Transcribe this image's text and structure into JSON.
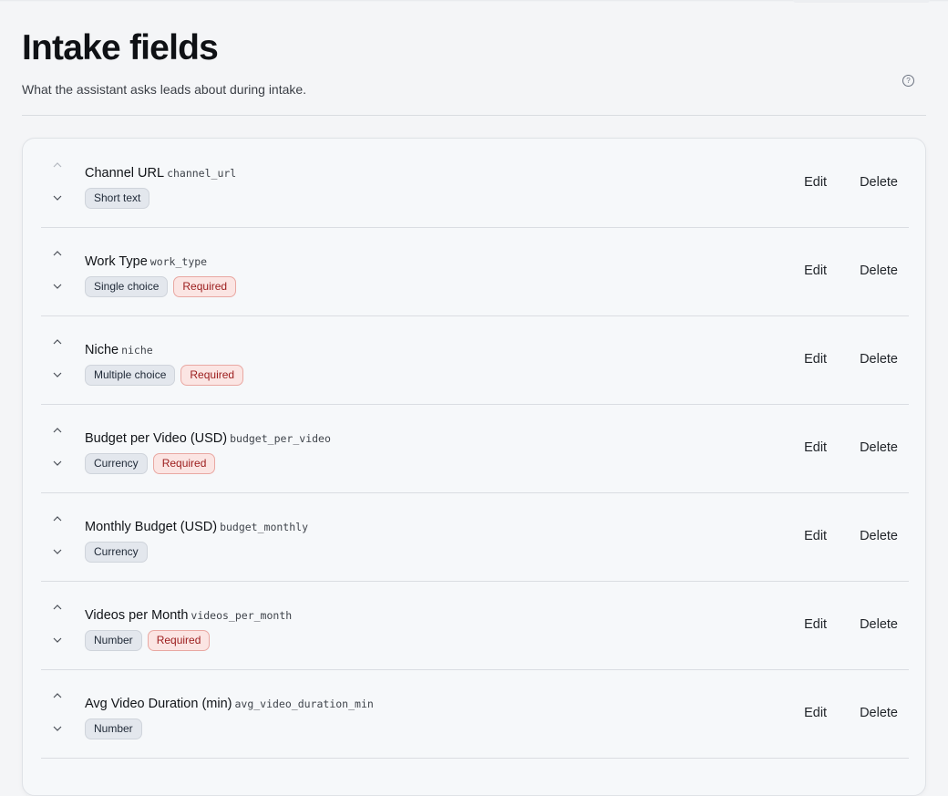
{
  "page": {
    "title": "Intake fields",
    "subtitle": "What the assistant asks leads about during intake.",
    "help_icon": "question-circle-icon",
    "help_glyph": "?"
  },
  "actions": {
    "edit_label": "Edit",
    "delete_label": "Delete"
  },
  "fields": [
    {
      "label": "Channel URL",
      "key": "channel_url",
      "type": "Short text",
      "required": false,
      "required_label": ""
    },
    {
      "label": "Work Type",
      "key": "work_type",
      "type": "Single choice",
      "required": true,
      "required_label": "Required"
    },
    {
      "label": "Niche",
      "key": "niche",
      "type": "Multiple choice",
      "required": true,
      "required_label": "Required"
    },
    {
      "label": "Budget per Video (USD)",
      "key": "budget_per_video",
      "type": "Currency",
      "required": true,
      "required_label": "Required"
    },
    {
      "label": "Monthly Budget (USD)",
      "key": "budget_monthly",
      "type": "Currency",
      "required": false,
      "required_label": ""
    },
    {
      "label": "Videos per Month",
      "key": "videos_per_month",
      "type": "Number",
      "required": true,
      "required_label": "Required"
    },
    {
      "label": "Avg Video Duration (min)",
      "key": "avg_video_duration_min",
      "type": "Number",
      "required": false,
      "required_label": ""
    }
  ],
  "colors": {
    "required_bg": "#fbe5e3",
    "required_text": "#9b1c1c",
    "type_badge_bg": "#e3e7ed"
  }
}
